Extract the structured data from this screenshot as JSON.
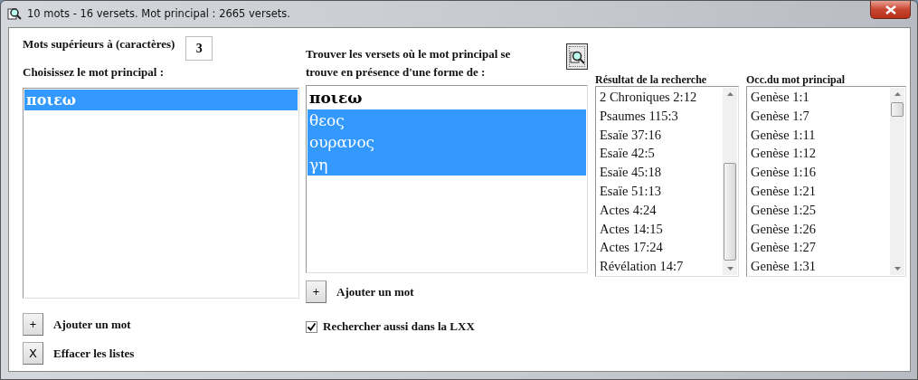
{
  "window": {
    "title": "10 mots - 16 versets. Mot principal : 2665 versets."
  },
  "min_length": {
    "label": "Mots supérieurs à (caractères)",
    "value": "3"
  },
  "main_word": {
    "label": "Choisissez le mot principal :",
    "items": [
      {
        "text": "ποιεω",
        "selected": true
      }
    ]
  },
  "left_buttons": [
    {
      "kind": "add",
      "symbol": "+",
      "label": "Ajouter un mot"
    },
    {
      "kind": "clear",
      "symbol": "X",
      "label": "Effacer les listes"
    }
  ],
  "companion": {
    "heading": "Trouver les versets où le mot principal se trouve en présence d'une forme de :",
    "items": [
      {
        "text": "ποιεω",
        "selected": false
      },
      {
        "text": "θεος",
        "selected": true
      },
      {
        "text": "ουρανος",
        "selected": true
      },
      {
        "text": "γη",
        "selected": true
      }
    ],
    "button": {
      "symbol": "+",
      "label": "Ajouter un mot"
    },
    "lxx": {
      "label": "Rechercher aussi dans la LXX",
      "checked": true
    }
  },
  "results": {
    "heading": "Résultat de la recherche",
    "items": [
      "2 Chroniques 2:12",
      "Psaumes 115:3",
      "Esaïe 37:16",
      "Esaïe 42:5",
      "Esaïe 45:18",
      "Esaïe 51:13",
      "Actes 4:24",
      "Actes 14:15",
      "Actes 17:24",
      "Révélation 14:7"
    ]
  },
  "occurrences": {
    "heading": "Occ.du mot principal",
    "items": [
      "Genèse 1:1",
      "Genèse 1:7",
      "Genèse 1:11",
      "Genèse 1:12",
      "Genèse 1:16",
      "Genèse 1:21",
      "Genèse 1:25",
      "Genèse 1:26",
      "Genèse 1:27",
      "Genèse 1:31"
    ]
  }
}
